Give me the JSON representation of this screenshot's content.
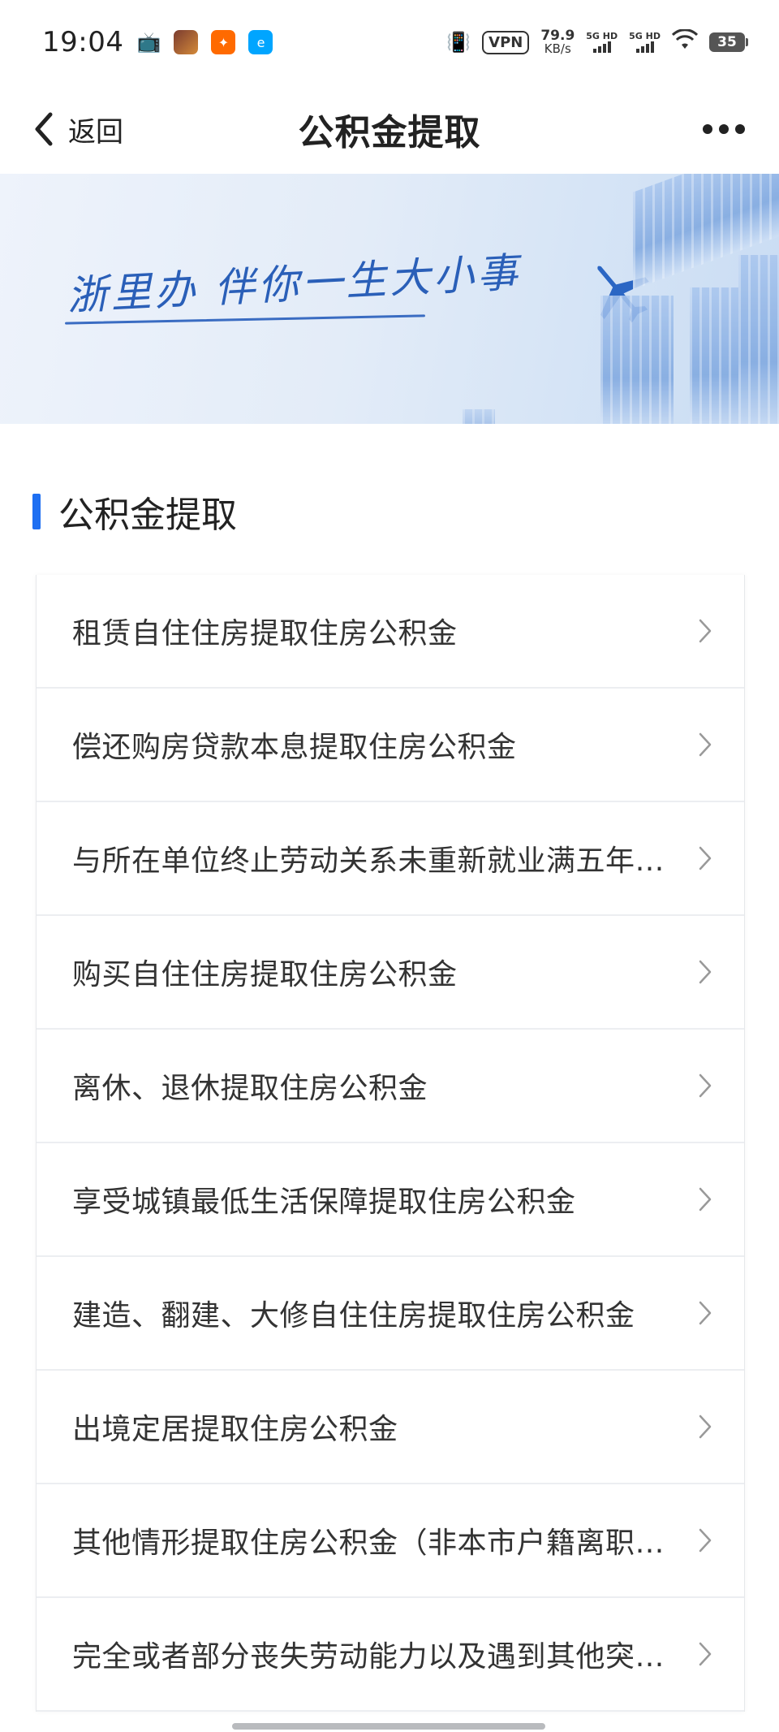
{
  "status_bar": {
    "time": "19:04",
    "vpn": "VPN",
    "net_speed_value": "79.9",
    "net_speed_unit": "KB/s",
    "sim1": "5G HD",
    "sim2": "5G HD",
    "battery": "35"
  },
  "nav": {
    "back_label": "返回",
    "title": "公积金提取"
  },
  "banner": {
    "slogan": "浙里办 伴你一生大小事"
  },
  "section": {
    "title": "公积金提取"
  },
  "list": {
    "items": [
      {
        "label": "租赁自住住房提取住房公积金"
      },
      {
        "label": "偿还购房贷款本息提取住房公积金"
      },
      {
        "label": "与所在单位终止劳动关系未重新就业满五年…"
      },
      {
        "label": "购买自住住房提取住房公积金"
      },
      {
        "label": "离休、退休提取住房公积金"
      },
      {
        "label": "享受城镇最低生活保障提取住房公积金"
      },
      {
        "label": "建造、翻建、大修自住住房提取住房公积金"
      },
      {
        "label": "出境定居提取住房公积金"
      },
      {
        "label": "其他情形提取住房公积金（非本市户籍离职未…"
      },
      {
        "label": "完全或者部分丧失劳动能力以及遇到其他突…"
      }
    ]
  },
  "colors": {
    "accent": "#1e6ff2",
    "banner_text": "#2a5fb8"
  }
}
